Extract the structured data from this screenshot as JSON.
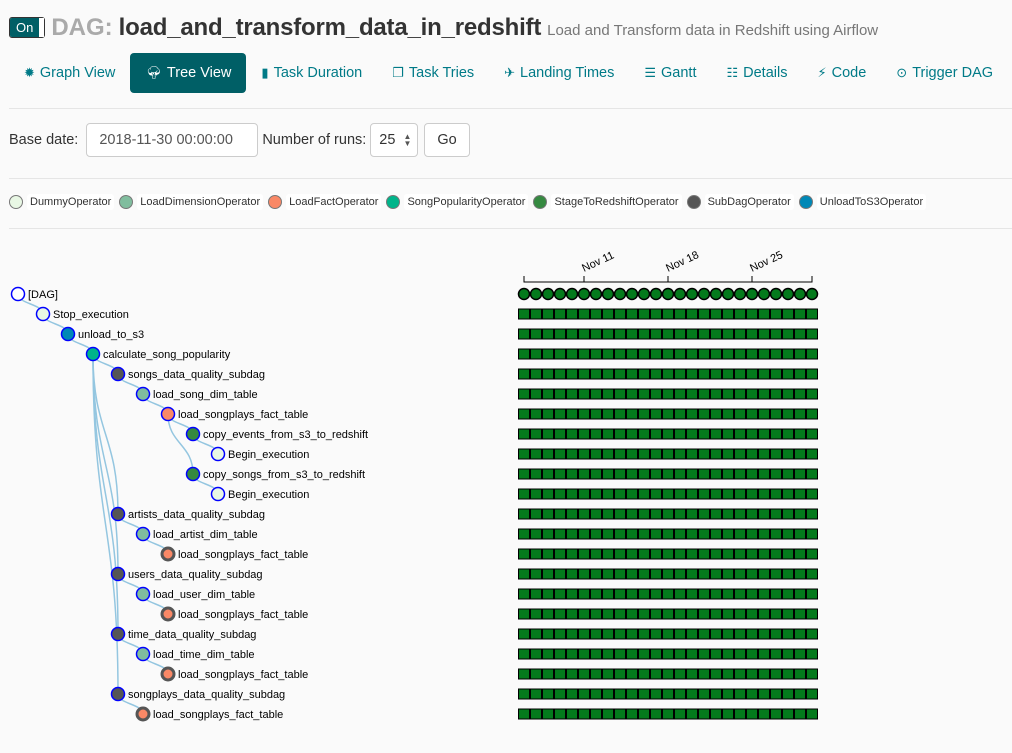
{
  "header": {
    "toggle_label": "On",
    "dag_label": "DAG:",
    "dag_id": "load_and_transform_data_in_redshift",
    "description": "Load and Transform data in Redshift using Airflow"
  },
  "nav": {
    "tabs": [
      {
        "label": "Graph View",
        "icon": "graph-icon",
        "glyph": "✹",
        "active": false
      },
      {
        "label": "Tree View",
        "icon": "tree-icon",
        "glyph": "🌳︎",
        "active": true
      },
      {
        "label": "Task Duration",
        "icon": "bar-chart-icon",
        "glyph": "▮",
        "active": false
      },
      {
        "label": "Task Tries",
        "icon": "files-icon",
        "glyph": "❐",
        "active": false
      },
      {
        "label": "Landing Times",
        "icon": "plane-icon",
        "glyph": "✈",
        "active": false
      },
      {
        "label": "Gantt",
        "icon": "tasks-icon",
        "glyph": "☰",
        "active": false
      },
      {
        "label": "Details",
        "icon": "list-icon",
        "glyph": "☷",
        "active": false
      },
      {
        "label": "Code",
        "icon": "flash-icon",
        "glyph": "⚡︎",
        "active": false
      },
      {
        "label": "Trigger DAG",
        "icon": "play-circle-icon",
        "glyph": "⊙",
        "active": false
      }
    ]
  },
  "form": {
    "base_date_label": "Base date:",
    "base_date_value": "2018-11-30 00:00:00",
    "num_runs_label": "Number of runs:",
    "num_runs_value": "25",
    "go_label": "Go"
  },
  "legend": [
    {
      "name": "DummyOperator",
      "color": "#e8f7e4"
    },
    {
      "name": "LoadDimensionOperator",
      "color": "#80bd9e"
    },
    {
      "name": "LoadFactOperator",
      "color": "#f98866"
    },
    {
      "name": "SongPopularityOperator",
      "color": "#00b48a"
    },
    {
      "name": "StageToRedshiftOperator",
      "color": "#358940"
    },
    {
      "name": "SubDagOperator",
      "color": "#555555"
    },
    {
      "name": "UnloadToS3Operator",
      "color": "#0088b6"
    }
  ],
  "colors": {
    "node_stroke": "#0000ff",
    "collapsed_stroke": "#555555",
    "link": "#94c6e0",
    "success": "#047a1c"
  },
  "timeline": {
    "ticks": [
      "Nov 11",
      "Nov 18",
      "Nov 25"
    ],
    "num_runs": 25,
    "run_state": "success"
  },
  "tree": {
    "name": "[DAG]",
    "op": "DummyOperator",
    "dag_root": true,
    "children": [
      {
        "name": "Stop_execution",
        "op": "DummyOperator",
        "children": [
          {
            "name": "unload_to_s3",
            "op": "UnloadToS3Operator",
            "children": [
              {
                "name": "calculate_song_popularity",
                "op": "SongPopularityOperator",
                "children": [
                  {
                    "name": "songs_data_quality_subdag",
                    "op": "SubDagOperator",
                    "children": [
                      {
                        "name": "load_song_dim_table",
                        "op": "LoadDimensionOperator",
                        "children": [
                          {
                            "name": "load_songplays_fact_table",
                            "op": "LoadFactOperator",
                            "children": [
                              {
                                "name": "copy_events_from_s3_to_redshift",
                                "op": "StageToRedshiftOperator",
                                "children": [
                                  {
                                    "name": "Begin_execution",
                                    "op": "DummyOperator"
                                  }
                                ]
                              },
                              {
                                "name": "copy_songs_from_s3_to_redshift",
                                "op": "StageToRedshiftOperator",
                                "children": [
                                  {
                                    "name": "Begin_execution",
                                    "op": "DummyOperator"
                                  }
                                ]
                              }
                            ]
                          }
                        ]
                      }
                    ]
                  },
                  {
                    "name": "artists_data_quality_subdag",
                    "op": "SubDagOperator",
                    "children": [
                      {
                        "name": "load_artist_dim_table",
                        "op": "LoadDimensionOperator",
                        "children": [
                          {
                            "name": "load_songplays_fact_table",
                            "op": "LoadFactOperator",
                            "collapsed": true
                          }
                        ]
                      }
                    ]
                  },
                  {
                    "name": "users_data_quality_subdag",
                    "op": "SubDagOperator",
                    "children": [
                      {
                        "name": "load_user_dim_table",
                        "op": "LoadDimensionOperator",
                        "children": [
                          {
                            "name": "load_songplays_fact_table",
                            "op": "LoadFactOperator",
                            "collapsed": true
                          }
                        ]
                      }
                    ]
                  },
                  {
                    "name": "time_data_quality_subdag",
                    "op": "SubDagOperator",
                    "children": [
                      {
                        "name": "load_time_dim_table",
                        "op": "LoadDimensionOperator",
                        "children": [
                          {
                            "name": "load_songplays_fact_table",
                            "op": "LoadFactOperator",
                            "collapsed": true
                          }
                        ]
                      }
                    ]
                  },
                  {
                    "name": "songplays_data_quality_subdag",
                    "op": "SubDagOperator",
                    "children": [
                      {
                        "name": "load_songplays_fact_table",
                        "op": "LoadFactOperator",
                        "collapsed": true
                      }
                    ]
                  }
                ]
              }
            ]
          }
        ]
      }
    ]
  }
}
